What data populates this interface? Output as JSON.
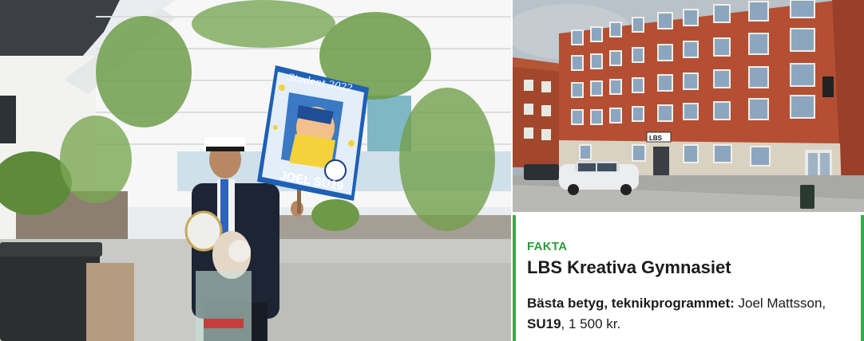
{
  "left_photo": {
    "sign_top_text": "Student 2022",
    "sign_bottom_text": "JOEL SU19"
  },
  "right_photo": {
    "building_sign": "LBS"
  },
  "fact_box": {
    "label": "FAKTA",
    "title": "LBS Kreativa Gymnasiet",
    "line_prefix": "Bästa betyg, teknikprogrammet:",
    "line_name": " Joel Mattsson,",
    "line_class": "SU19",
    "line_amount": ", 1 500 kr.",
    "accent_color": "#3aa947"
  }
}
